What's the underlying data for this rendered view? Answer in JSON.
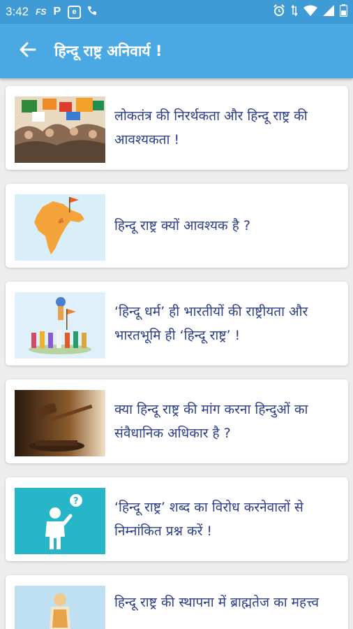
{
  "status_bar": {
    "time": "3:42",
    "icons": [
      "FS",
      "P",
      "e",
      "phone-icon"
    ],
    "right_icons": [
      "alarm-icon",
      "data-arrows-icon",
      "wifi-icon",
      "signal-icon",
      "battery-icon"
    ]
  },
  "app_bar": {
    "title": "हिन्दू राष्ट्र अनिवार्य !",
    "back_icon": "arrow-back-icon"
  },
  "colors": {
    "status": "#3e9bd6",
    "appbar": "#4aa9e3",
    "text": "#2c3e8a",
    "background": "#ededed"
  },
  "articles": [
    {
      "title": "लोकतंत्र की निरर्थकता और हिन्दू राष्ट्र की आवश्यकता !"
    },
    {
      "title": "हिन्दू राष्ट्र क्यों आवश्यक है ?"
    },
    {
      "title": "‘हिन्दू धर्म’ ही भारतीयों की राष्ट्रीयता और भारतभूमि ही ‘हिन्दू राष्ट्र’ !"
    },
    {
      "title": "क्या हिन्दू राष्ट्र की मांग करना हिन्दुओं का संवैधानिक अधिकार है ?"
    },
    {
      "title": "‘हिन्दू राष्ट्र’ शब्द का विरोध करनेवालों से निम्नांकित प्रश्न करें !"
    },
    {
      "title": "हिन्दू राष्ट्र की स्थापना में ब्राह्मतेज का महत्त्व"
    }
  ]
}
